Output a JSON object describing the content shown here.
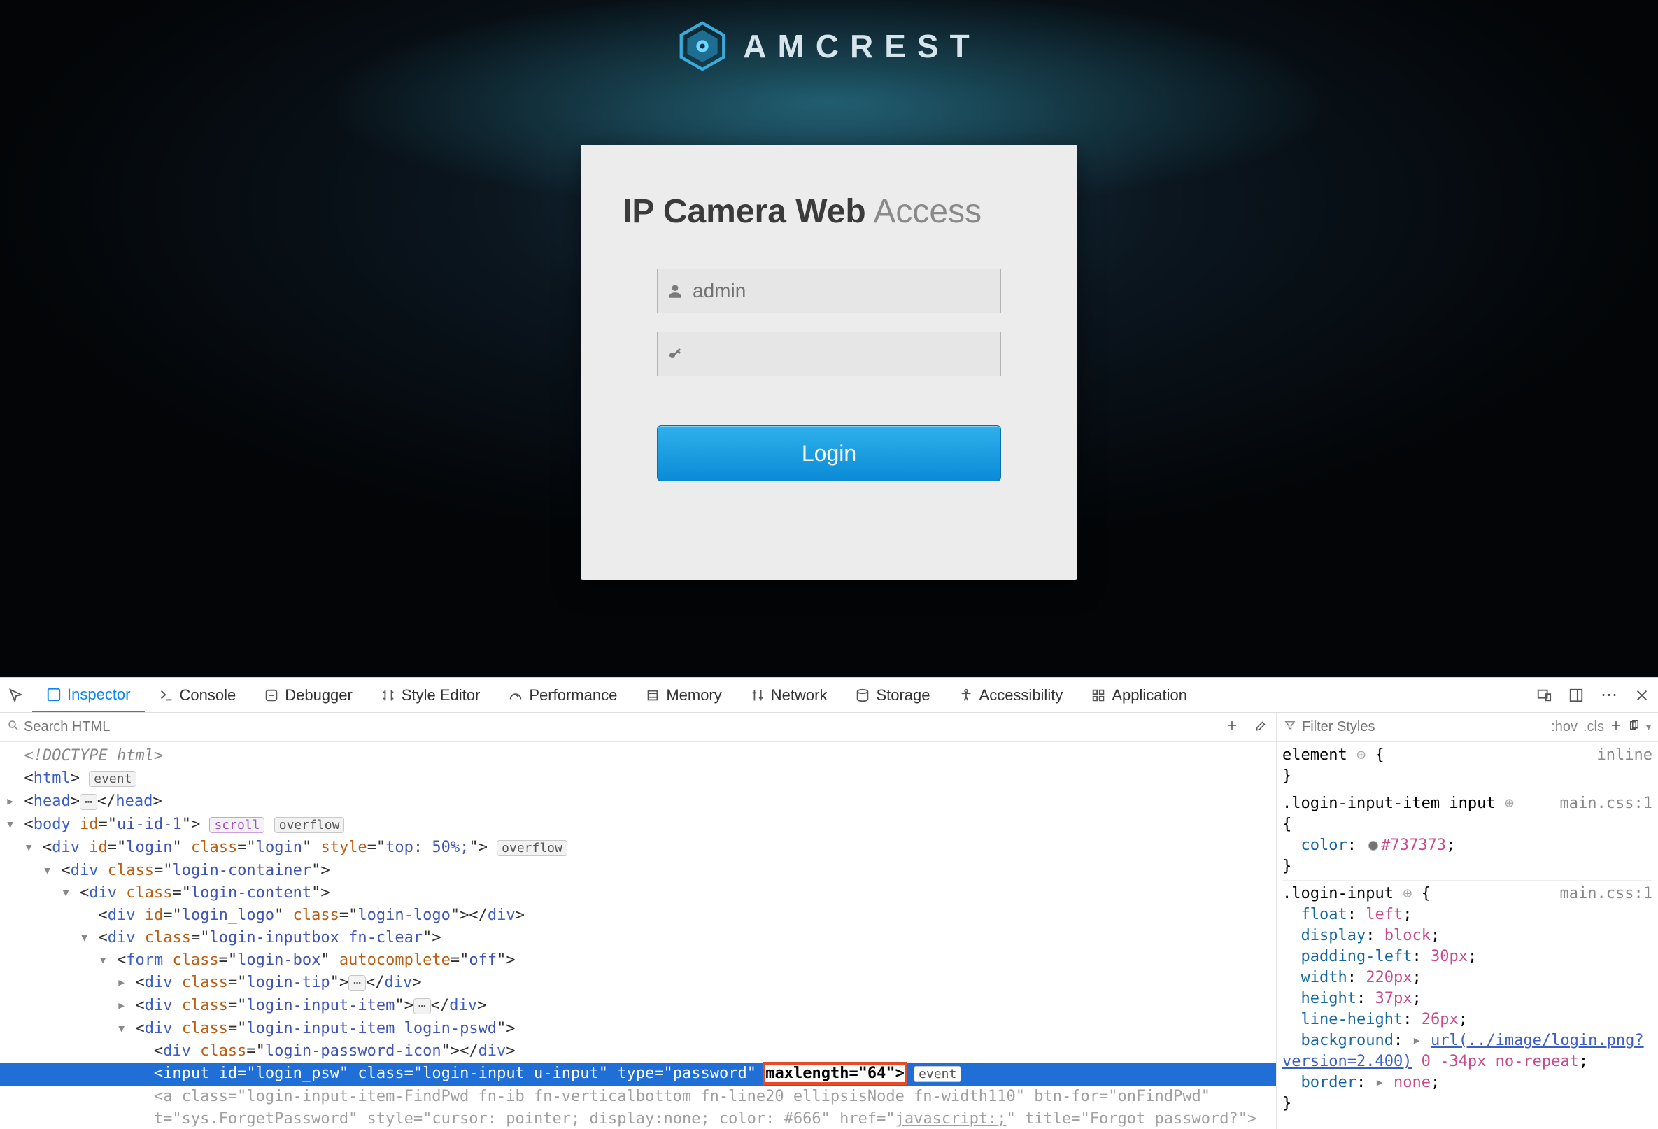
{
  "brand": {
    "name": "AMCREST"
  },
  "login": {
    "title_bold": "IP Camera Web",
    "title_thin": " Access",
    "username_value": "admin",
    "password_value": "",
    "button_label": "Login"
  },
  "devtools": {
    "tabs": {
      "inspector": "Inspector",
      "console": "Console",
      "debugger": "Debugger",
      "style_editor": "Style Editor",
      "performance": "Performance",
      "memory": "Memory",
      "network": "Network",
      "storage": "Storage",
      "accessibility": "Accessibility",
      "application": "Application"
    },
    "search_placeholder": "Search HTML",
    "styles_pane": {
      "filter_placeholder": "Filter Styles",
      "hov": ":hov",
      "cls": ".cls"
    },
    "dom_lines": {
      "l0": "<!DOCTYPE html>",
      "l1_a": "<",
      "l1_b": "html",
      "l1_c": ">",
      "l1_pill": "event",
      "l2": "  <head>⋯</head>",
      "l3_a": "  <",
      "l3_b": "body",
      "l3_attrs": " id=\"ui-id-1\">",
      "l3_p1": "scroll",
      "l3_p2": "overflow",
      "l4": "    <div id=\"login\" class=\"login\" style=\"top: 50%;\">",
      "l4_p": "overflow",
      "l5": "      <div class=\"login-container\">",
      "l6": "        <div class=\"login-content\">",
      "l7": "          <div id=\"login_logo\" class=\"login-logo\"></div>",
      "l8": "          <div class=\"login-inputbox fn-clear\">",
      "l9": "            <form class=\"login-box\" autocomplete=\"off\">",
      "l10": "              <div class=\"login-tip\">⋯</div>",
      "l11": "              <div class=\"login-input-item\">⋯</div>",
      "l12": "              <div class=\"login-input-item login-pswd\">",
      "l13": "                <div class=\"login-password-icon\"></div>",
      "l14_pre": "                <input id=\"login_psw\" class=\"login-input u-input\" type=\"password\" ",
      "l14_hl": "maxlength=\"64\">",
      "l14_pill": "event",
      "l15_a": "                <a class=\"login-input-item-FindPwd fn-ib fn-verticalbottom fn-line20 ellipsisNode fn-width110\" btn-for=\"onFindPwd\"",
      "l15_b": "                t=\"sys.ForgetPassword\" style=\"cursor: pointer; display:none; color: #666\" href=\"javascript:;\" title=\"Forgot password?\">"
    },
    "css_rules": {
      "element_label": "element",
      "inline_label": "inline",
      "r1_sel": ".login-input-item input",
      "r1_src": "main.css:1",
      "r1_p1k": "color",
      "r1_p1v": "#737373",
      "r2_sel": ".login-input",
      "r2_src": "main.css:1",
      "r2_float_k": "float",
      "r2_float_v": "left",
      "r2_display_k": "display",
      "r2_display_v": "block",
      "r2_pl_k": "padding-left",
      "r2_pl_v": "30px",
      "r2_w_k": "width",
      "r2_w_v": "220px",
      "r2_h_k": "height",
      "r2_h_v": "37px",
      "r2_lh_k": "line-height",
      "r2_lh_v": "26px",
      "r2_bg_k": "background",
      "r2_bg_url": "url(../image/login.png?version=2.400)",
      "r2_bg_suffix": " 0 -34px no-repeat",
      "r2_border_k": "border",
      "r2_border_v": "none"
    }
  }
}
